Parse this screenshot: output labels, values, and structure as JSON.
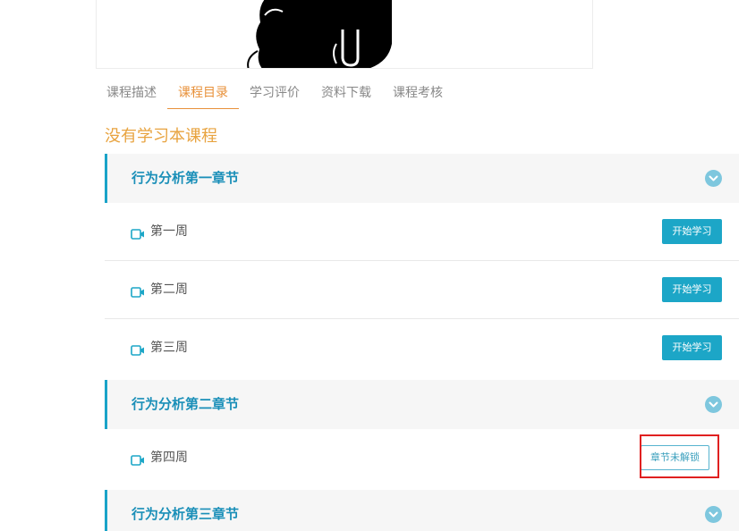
{
  "tabs": [
    {
      "label": "课程描述"
    },
    {
      "label": "课程目录"
    },
    {
      "label": "学习评价"
    },
    {
      "label": "资料下载"
    },
    {
      "label": "课程考核"
    }
  ],
  "active_tab": "课程目录",
  "status_title": "没有学习本课程",
  "chapters": [
    {
      "title": "行为分析第一章节",
      "lessons": [
        {
          "label": "第一周",
          "action": "开始学习"
        },
        {
          "label": "第二周",
          "action": "开始学习"
        },
        {
          "label": "第三周",
          "action": "开始学习"
        }
      ]
    },
    {
      "title": "行为分析第二章节",
      "lessons": [
        {
          "label": "第四周",
          "action": "章节未解锁"
        }
      ]
    },
    {
      "title": "行为分析第三章节",
      "lessons": []
    }
  ],
  "colors": {
    "accent_orange": "#e8913a",
    "accent_blue": "#1ca6c7",
    "chapter_title": "#1a8fb8",
    "highlight_red": "#e02020"
  },
  "icons": {
    "lesson": "video-camera-icon",
    "chapter_toggle": "chevron-down-icon"
  }
}
